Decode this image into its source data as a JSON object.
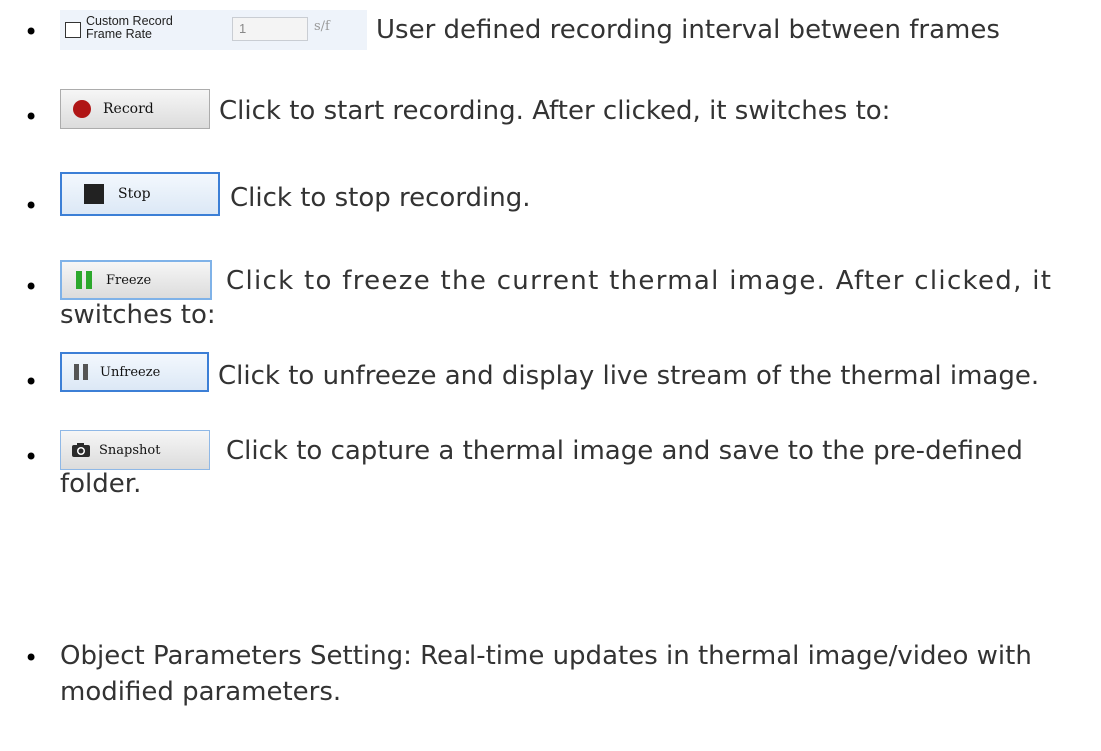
{
  "frame_rate": {
    "checkbox_label_line1": "Custom Record",
    "checkbox_label_line2": "Frame Rate",
    "value": "1",
    "unit": "s/f",
    "description": "User defined recording interval between frames"
  },
  "record": {
    "button_label": "Record",
    "description": "Click to start recording. After clicked, it switches to:",
    "icon": "record-dot-icon",
    "icon_color": "#b01616"
  },
  "stop": {
    "button_label": "Stop",
    "description": "Click to stop recording.",
    "icon": "stop-square-icon"
  },
  "freeze": {
    "button_label": "Freeze",
    "description_line1": "Click to freeze the current thermal image. After clicked, it",
    "description_line2": "switches to:",
    "icon": "pause-bars-icon",
    "icon_color": "#2ca82c"
  },
  "unfreeze": {
    "button_label": "Unfreeze",
    "description": "Click to unfreeze and display live stream of the thermal image.",
    "icon": "pause-bars-icon",
    "icon_color": "#555555"
  },
  "snapshot": {
    "button_label": "Snapshot",
    "description_line1": "Click to capture a thermal image and save to the pre-defined",
    "description_line2": "folder.",
    "icon": "camera-icon"
  },
  "object_params": {
    "line1": "Object Parameters Setting: Real-time updates in thermal image/video with",
    "line2": "modified parameters."
  }
}
